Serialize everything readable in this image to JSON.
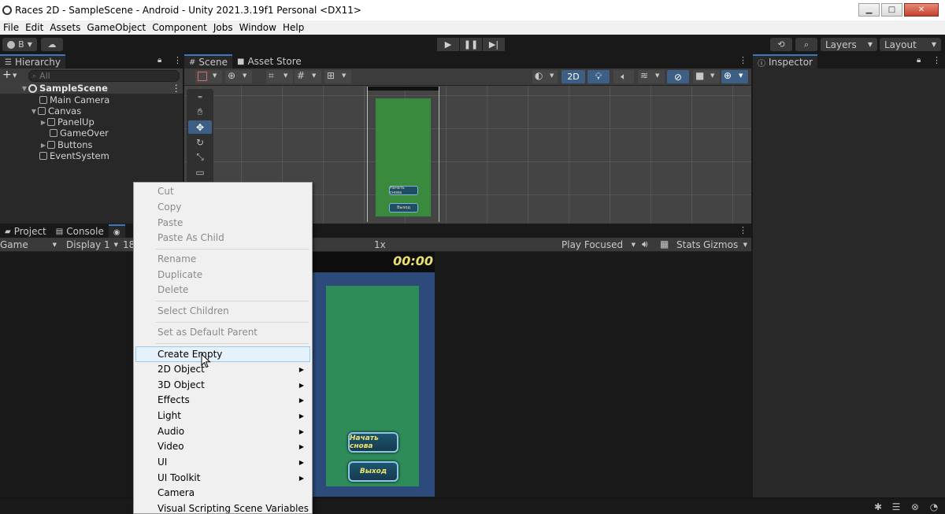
{
  "window": {
    "title": "Races 2D - SampleScene - Android - Unity 2021.3.19f1 Personal <DX11>",
    "buttons": {
      "minimize": "▁",
      "maximize": "□",
      "close": "✕"
    }
  },
  "menubar": [
    "File",
    "Edit",
    "Assets",
    "GameObject",
    "Component",
    "Jobs",
    "Window",
    "Help"
  ],
  "toolbar": {
    "account_label": "B",
    "layers_label": "Layers",
    "layout_label": "Layout"
  },
  "hierarchy": {
    "tab_label": "Hierarchy",
    "search_placeholder": "All",
    "add_label": "+",
    "rows": [
      {
        "label": "SampleScene",
        "icon": "unity-scene-icon",
        "selected": true
      },
      {
        "label": "Main Camera"
      },
      {
        "label": "Canvas"
      },
      {
        "label": "PanelUp"
      },
      {
        "label": "GameOver"
      },
      {
        "label": "Buttons"
      },
      {
        "label": "EventSystem"
      }
    ]
  },
  "scene_tabs": {
    "scene": "Scene",
    "asset_store": "Asset Store"
  },
  "scene_toolbar": {
    "mode_2d": "2D"
  },
  "scene_ui": {
    "btn_restart": "Начать снова",
    "btn_exit": "Выход"
  },
  "bottom_tabs": {
    "project": "Project",
    "console": "Console"
  },
  "game_toolbar": {
    "game_label": "Game",
    "display_label": "Display 1",
    "resolution_partial": "18",
    "scale_value": "1x",
    "play_focused": "Play Focused",
    "stats": "Stats",
    "gizmos": "Gizmos"
  },
  "game_ui": {
    "timer": "00:00",
    "btn_restart": "Начать снова",
    "btn_exit": "Выход"
  },
  "inspector": {
    "tab_label": "Inspector"
  },
  "context_menu": {
    "items": [
      {
        "label": "Cut",
        "disabled": true
      },
      {
        "label": "Copy",
        "disabled": true
      },
      {
        "label": "Paste",
        "disabled": true
      },
      {
        "label": "Paste As Child",
        "disabled": true
      },
      {
        "label": "Rename",
        "disabled": true
      },
      {
        "label": "Duplicate",
        "disabled": true
      },
      {
        "label": "Delete",
        "disabled": true
      },
      {
        "label": "Select Children",
        "disabled": true
      },
      {
        "label": "Set as Default Parent",
        "disabled": true
      },
      {
        "label": "Create Empty",
        "hover": true
      },
      {
        "label": "2D Object",
        "submenu": true
      },
      {
        "label": "3D Object",
        "submenu": true
      },
      {
        "label": "Effects",
        "submenu": true
      },
      {
        "label": "Light",
        "submenu": true
      },
      {
        "label": "Audio",
        "submenu": true
      },
      {
        "label": "Video",
        "submenu": true
      },
      {
        "label": "UI",
        "submenu": true
      },
      {
        "label": "UI Toolkit",
        "submenu": true
      },
      {
        "label": "Camera"
      },
      {
        "label": "Visual Scripting Scene Variables"
      }
    ]
  },
  "colors": {
    "accent": "#3a79bb",
    "scene_green": "#3a8a3e",
    "game_green": "#2e8b5a",
    "game_blue": "#2c4a7a",
    "timer_yellow": "#e8e070"
  }
}
